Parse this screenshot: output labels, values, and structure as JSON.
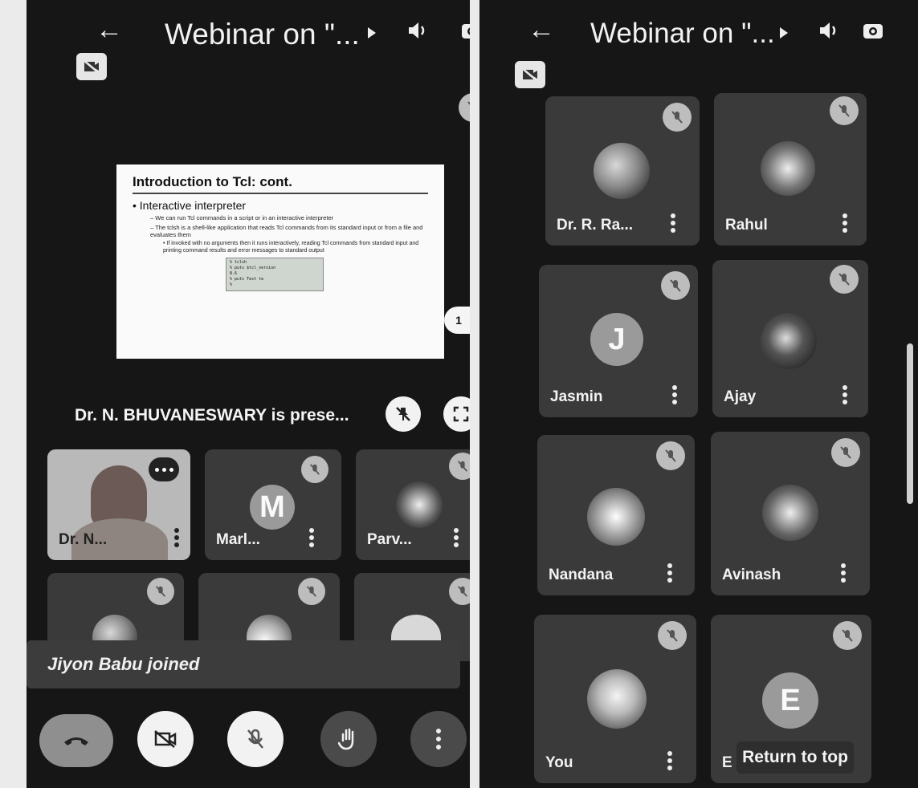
{
  "left_screen": {
    "title": "Webinar on \"...",
    "slide": {
      "heading": "Introduction to Tcl: cont.",
      "bullet": "Interactive interpreter",
      "sub1": "– We can run Tcl commands in a script or in an interactive interpreter",
      "sub2": "– The tclsh is a shell-like application that reads Tcl commands from its standard input or from a file and evaluates them",
      "sub3": "• If invoked with no arguments then it runs interactively, reading Tcl commands from standard input and printing command results and error messages to standard output",
      "code": "% tclsh\n% puts $tcl_version\n8.6\n% puts Test te\n%"
    },
    "page_badge": "1",
    "presenting_text": "Dr. N. BHUVANESWARY is prese...",
    "participants": [
      {
        "name": "Dr. N..."
      },
      {
        "name": "Marl...",
        "initial": "M"
      },
      {
        "name": "Parv..."
      }
    ],
    "toast": "Jiyon Babu joined"
  },
  "right_screen": {
    "title": "Webinar on \"...",
    "participants": [
      {
        "name": "Dr. R. Ra..."
      },
      {
        "name": "Rahul"
      },
      {
        "name": "Jasmin",
        "initial": "J"
      },
      {
        "name": "Ajay"
      },
      {
        "name": "Nandana"
      },
      {
        "name": "Avinash"
      },
      {
        "name": "You"
      },
      {
        "name": "E",
        "initial": "E"
      }
    ],
    "return_to_top": "Return to top"
  },
  "colors": {
    "screen_bg": "#161616",
    "tile_bg": "#3a3a3a",
    "end_call": "#8f8f8f"
  }
}
